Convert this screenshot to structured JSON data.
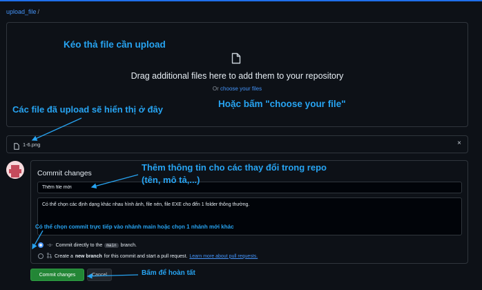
{
  "breadcrumb": {
    "repo": "upload_file",
    "separator": "/"
  },
  "dropzone": {
    "title": "Drag additional files here to add them to your repository",
    "or_text": "Or",
    "choose_link": "choose your files"
  },
  "file": {
    "name": "1-6.png",
    "close_symbol": "×"
  },
  "commit": {
    "heading": "Commit changes",
    "summary_value": "Thêm file mới",
    "description_value": "Có thể chọn các định dạng khác nhau hình ảnh, file nén, file EXE cho đến 1 folder thông thường.",
    "option_direct": {
      "before": "Commit directly to the",
      "branch": "main",
      "after": "branch.",
      "selected": true
    },
    "option_new": {
      "prefix": "Create a",
      "bold": "new branch",
      "rest": "for this commit and start a pull request.",
      "link": "Learn more about pull requests.",
      "selected": false
    }
  },
  "buttons": {
    "commit": "Commit changes",
    "cancel": "Cancel"
  },
  "annotations": {
    "drag": "Kéo thả file cần upload",
    "uploaded": "Các file đã upload sẽ hiển thị ở đây",
    "choose": "Hoặc bấm \"choose your file\"",
    "info_line1": "Thêm thông tin cho các thay đổi trong repo",
    "info_line2": "(tên, mô tả,...)",
    "branch": "Có thể chọn commit trực tiếp vào nhánh main hoặc chọn 1 nhánh mới khác",
    "finish": "Bấm để hoàn tất"
  },
  "colors": {
    "accent": "#4493f8",
    "annotation": "#27a4f2",
    "primary_button": "#238636",
    "background": "#0d1117",
    "border": "#30363d"
  },
  "icons": [
    "file-icon",
    "close-icon",
    "radio-icon",
    "git-commit-icon",
    "pull-request-icon",
    "avatar"
  ]
}
